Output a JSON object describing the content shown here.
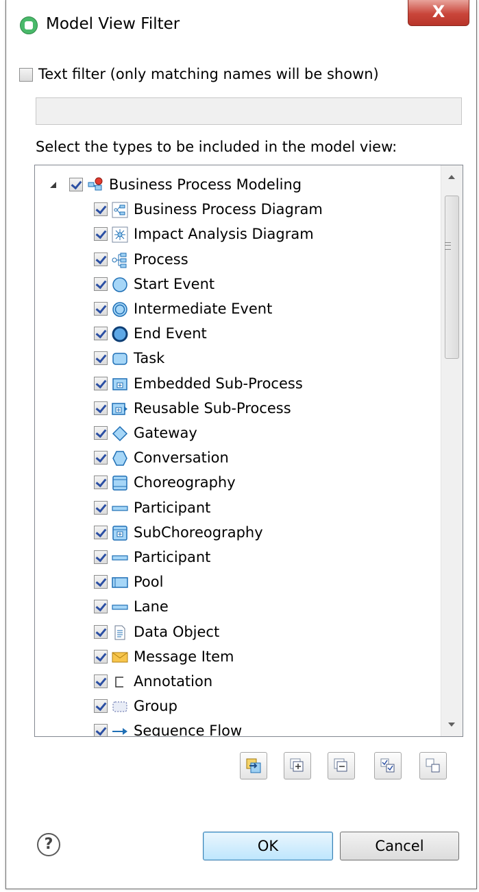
{
  "window": {
    "title": "Model View Filter",
    "close_label": "X"
  },
  "text_filter": {
    "label": "Text filter (only matching names will be shown)",
    "checked": false,
    "value": "",
    "placeholder": ""
  },
  "select_label": "Select the types to be included in the model view:",
  "tree": {
    "root": {
      "label": "Business Process Modeling",
      "checked": true,
      "expanded": true,
      "icon": "bpm-package-icon"
    },
    "items": [
      {
        "label": "Business Process Diagram",
        "icon": "process-diagram-icon",
        "checked": true
      },
      {
        "label": "Impact Analysis Diagram",
        "icon": "impact-diagram-icon",
        "checked": true
      },
      {
        "label": "Process",
        "icon": "process-icon",
        "checked": true
      },
      {
        "label": "Start Event",
        "icon": "start-event-icon",
        "checked": true
      },
      {
        "label": "Intermediate Event",
        "icon": "intermediate-event-icon",
        "checked": true
      },
      {
        "label": "End Event",
        "icon": "end-event-icon",
        "checked": true
      },
      {
        "label": "Task",
        "icon": "task-icon",
        "checked": true
      },
      {
        "label": "Embedded Sub-Process",
        "icon": "embedded-subprocess-icon",
        "checked": true
      },
      {
        "label": "Reusable Sub-Process",
        "icon": "reusable-subprocess-icon",
        "checked": true
      },
      {
        "label": "Gateway",
        "icon": "gateway-icon",
        "checked": true
      },
      {
        "label": "Conversation",
        "icon": "conversation-icon",
        "checked": true
      },
      {
        "label": "Choreography",
        "icon": "choreography-icon",
        "checked": true
      },
      {
        "label": "Participant",
        "icon": "participant-icon",
        "checked": true
      },
      {
        "label": "SubChoreography",
        "icon": "subchoreography-icon",
        "checked": true
      },
      {
        "label": "Participant",
        "icon": "participant-icon",
        "checked": true
      },
      {
        "label": "Pool",
        "icon": "pool-icon",
        "checked": true
      },
      {
        "label": "Lane",
        "icon": "lane-icon",
        "checked": true
      },
      {
        "label": "Data Object",
        "icon": "data-object-icon",
        "checked": true
      },
      {
        "label": "Message Item",
        "icon": "message-icon",
        "checked": true
      },
      {
        "label": "Annotation",
        "icon": "annotation-icon",
        "checked": true
      },
      {
        "label": "Group",
        "icon": "group-icon",
        "checked": true
      },
      {
        "label": "Sequence Flow",
        "icon": "sequence-flow-icon",
        "checked": true
      }
    ]
  },
  "toolbar": [
    {
      "name": "synchronize-button",
      "icon": "sync-icon"
    },
    {
      "name": "expand-all-button",
      "icon": "expand-all-icon"
    },
    {
      "name": "collapse-all-button",
      "icon": "collapse-all-icon"
    },
    {
      "name": "select-all-button",
      "icon": "select-all-icon"
    },
    {
      "name": "deselect-all-button",
      "icon": "deselect-all-icon"
    }
  ],
  "buttons": {
    "help_icon": "help-icon",
    "ok": "OK",
    "cancel": "Cancel"
  },
  "colors": {
    "accent": "#3c7fb1",
    "close": "#c9453a",
    "bpmn_blue": "#1f6fb5"
  }
}
